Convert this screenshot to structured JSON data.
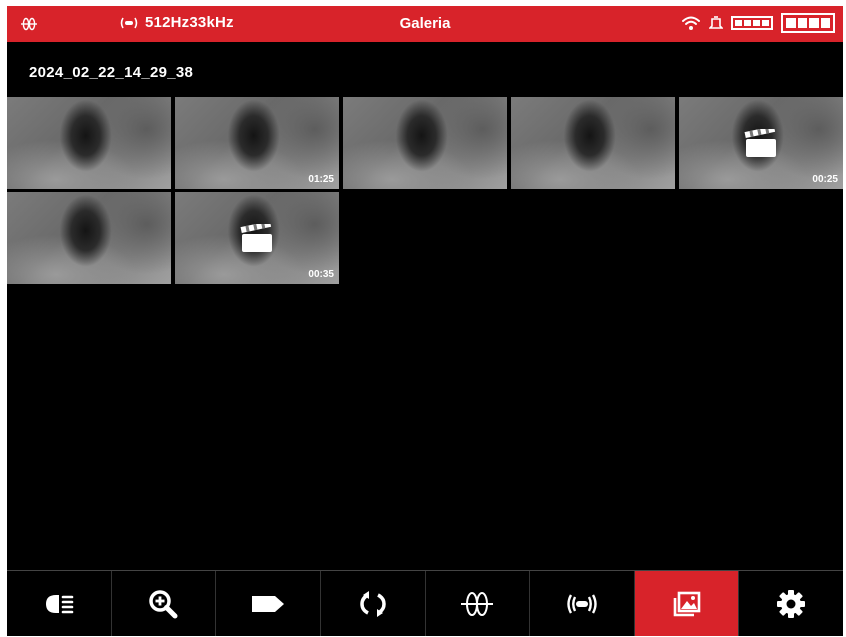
{
  "statusbar": {
    "locator_icon": "locator-grid-icon",
    "frequency_label": "512Hz33kHz",
    "title": "Galeria",
    "icons": [
      "wifi-icon",
      "bell-icon",
      "battery-small-icon",
      "battery-icon"
    ]
  },
  "gallery": {
    "folder_date": "2024_02_22_14_29_38",
    "thumbnails": [
      {
        "duration": "",
        "video_icon": false
      },
      {
        "duration": "01:25",
        "video_icon": false
      },
      {
        "duration": "",
        "video_icon": false
      },
      {
        "duration": "",
        "video_icon": false
      },
      {
        "duration": "00:25",
        "video_icon": true
      },
      {
        "duration": "",
        "video_icon": false
      },
      {
        "duration": "00:35",
        "video_icon": true
      }
    ]
  },
  "toolbar": {
    "items": [
      {
        "icon": "headlight-icon",
        "active": false
      },
      {
        "icon": "zoom-in-icon",
        "active": false
      },
      {
        "icon": "tag-icon",
        "active": false
      },
      {
        "icon": "rotate-icon",
        "active": false
      },
      {
        "icon": "locator-grid-icon",
        "active": false
      },
      {
        "icon": "sonde-icon",
        "active": false
      },
      {
        "icon": "gallery-icon",
        "active": true
      },
      {
        "icon": "settings-gear-icon",
        "active": false
      }
    ]
  },
  "colors": {
    "accent": "#d8232a",
    "background": "#000000",
    "text": "#ffffff"
  }
}
